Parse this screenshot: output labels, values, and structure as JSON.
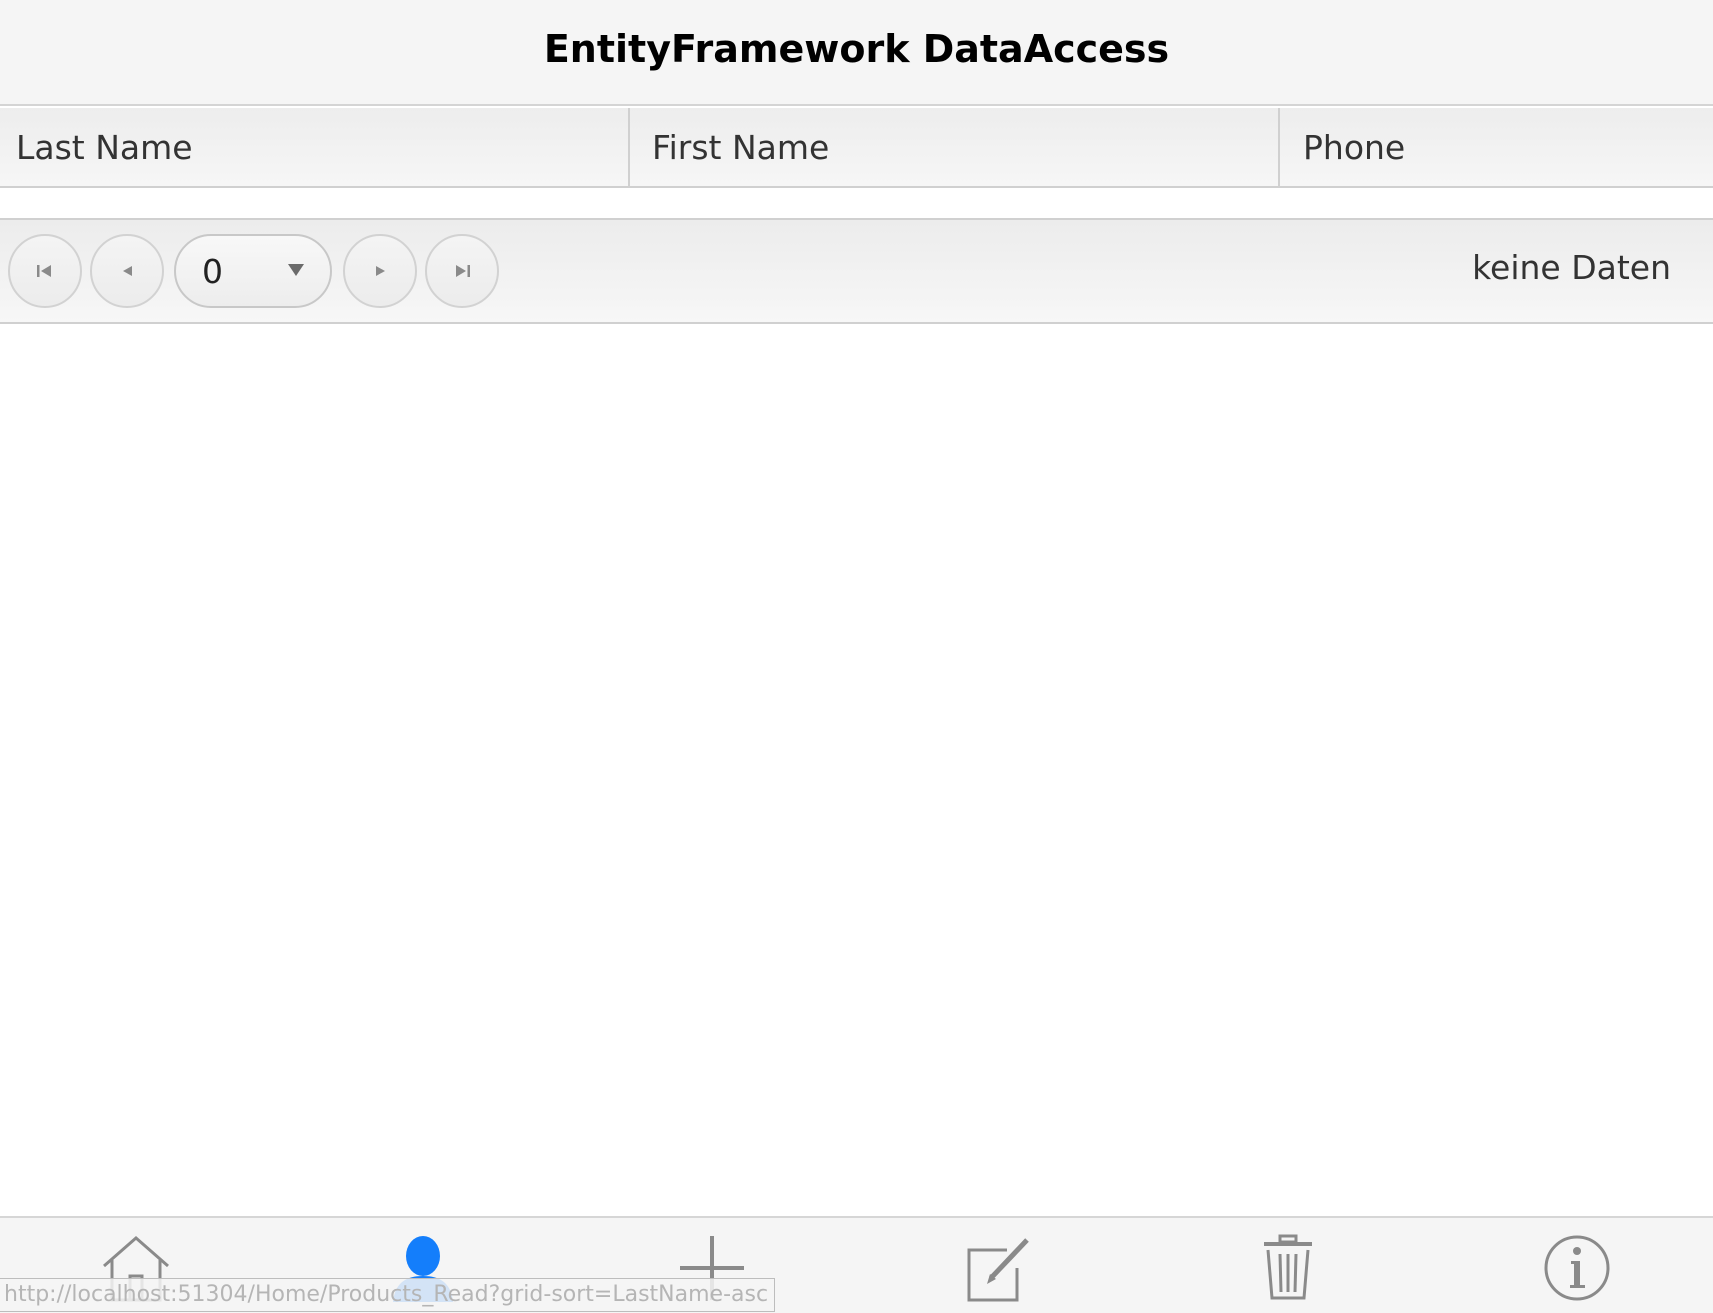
{
  "header": {
    "title": "EntityFramework DataAccess"
  },
  "grid": {
    "columns": [
      "Last Name",
      "First Name",
      "Phone"
    ],
    "rows": []
  },
  "pager": {
    "page_value": "0",
    "info": "keine Daten"
  },
  "tabbar": {
    "active_color": "#147efb",
    "icons": [
      "home-icon",
      "user-icon",
      "plus-icon",
      "edit-icon",
      "trash-icon",
      "info-icon"
    ]
  },
  "status_bar": {
    "url": "http://localhost:51304/Home/Products_Read?grid-sort=LastName-asc"
  }
}
